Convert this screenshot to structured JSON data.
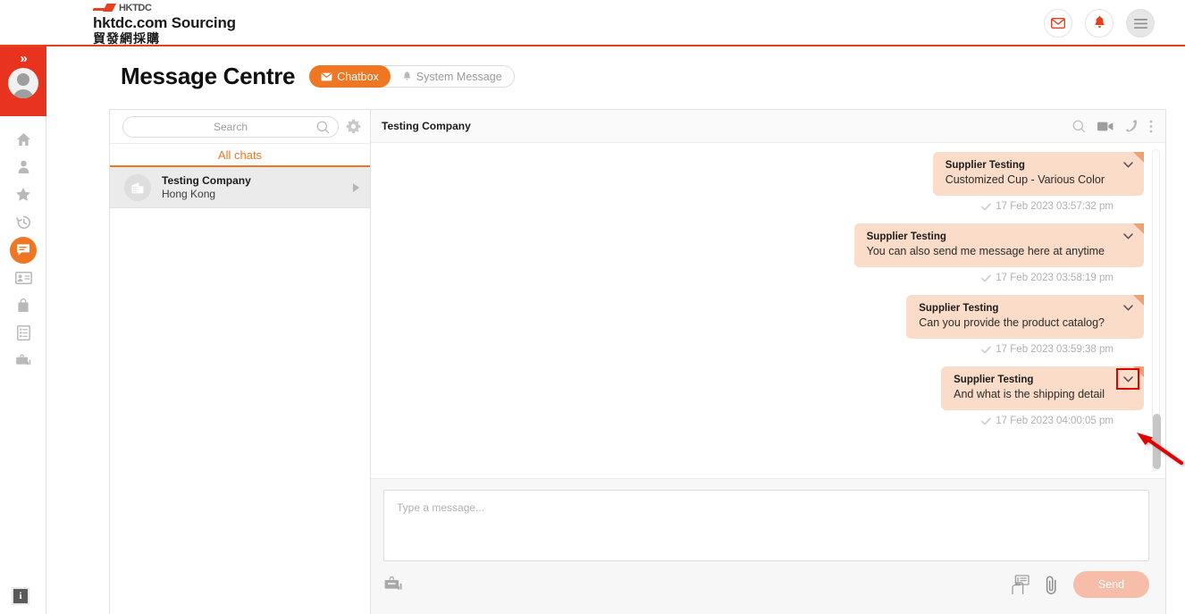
{
  "header": {
    "logo_text": "HKTDC",
    "brand_title": "hktdc.com Sourcing",
    "brand_subtitle": "貿發網採購",
    "icons": {
      "mail": "mail-icon",
      "bell": "bell-icon",
      "menu": "hamburger-menu-icon"
    }
  },
  "page": {
    "title": "Message Centre",
    "tabs": [
      {
        "label": "Chatbox",
        "icon": "mail-icon",
        "active": true
      },
      {
        "label": "System Message",
        "icon": "bell-icon",
        "active": false
      }
    ]
  },
  "rail": {
    "collapse": "»",
    "items": [
      {
        "name": "home",
        "label": "Home"
      },
      {
        "name": "profile",
        "label": "Profile"
      },
      {
        "name": "favourites",
        "label": "Favourites"
      },
      {
        "name": "history",
        "label": "History"
      },
      {
        "name": "messages",
        "label": "Messages",
        "active": true
      },
      {
        "name": "cards",
        "label": "Name Cards"
      },
      {
        "name": "bag",
        "label": "Bag"
      },
      {
        "name": "orders",
        "label": "Orders"
      },
      {
        "name": "trade-fairs",
        "label": "Trade Fairs"
      }
    ],
    "info": "i"
  },
  "chat_list": {
    "search_placeholder": "Search",
    "search_value": "",
    "settings_icon": "gear-icon",
    "filter_label": "All chats",
    "items": [
      {
        "name": "Testing Company",
        "location": "Hong Kong",
        "selected": true
      }
    ]
  },
  "conversation": {
    "title": "Testing Company",
    "tools": [
      "search-icon",
      "video-call-icon",
      "phone-call-icon",
      "more-options-icon"
    ],
    "messages": [
      {
        "sender": "Supplier Testing",
        "text": "Customized Cup - Various Color",
        "timestamp": "17 Feb 2023 03:57:32 pm",
        "status": "delivered",
        "highlighted": false
      },
      {
        "sender": "Supplier Testing",
        "text": "You can also send me message here at anytime",
        "timestamp": "17 Feb 2023 03:58:19 pm",
        "status": "delivered",
        "highlighted": false
      },
      {
        "sender": "Supplier Testing",
        "text": "Can you provide the product catalog?",
        "timestamp": "17 Feb 2023 03:59:38 pm",
        "status": "delivered",
        "highlighted": false
      },
      {
        "sender": "Supplier Testing",
        "text": "And what is the shipping detail",
        "timestamp": "17 Feb 2023 04:00:05 pm",
        "status": "delivered",
        "highlighted": true
      }
    ]
  },
  "compose": {
    "placeholder": "Type a message...",
    "value": "",
    "send_label": "Send",
    "icons": [
      "product-catalog-icon",
      "quick-reply-icon",
      "attachment-icon"
    ]
  },
  "colors": {
    "brand_orange": "#e8401f",
    "accent_orange": "#ef7622",
    "bubble": "#fadcc8",
    "bubble_fold": "#f0a072",
    "highlight": "#e00000",
    "send_disabled": "#f7bda8"
  }
}
